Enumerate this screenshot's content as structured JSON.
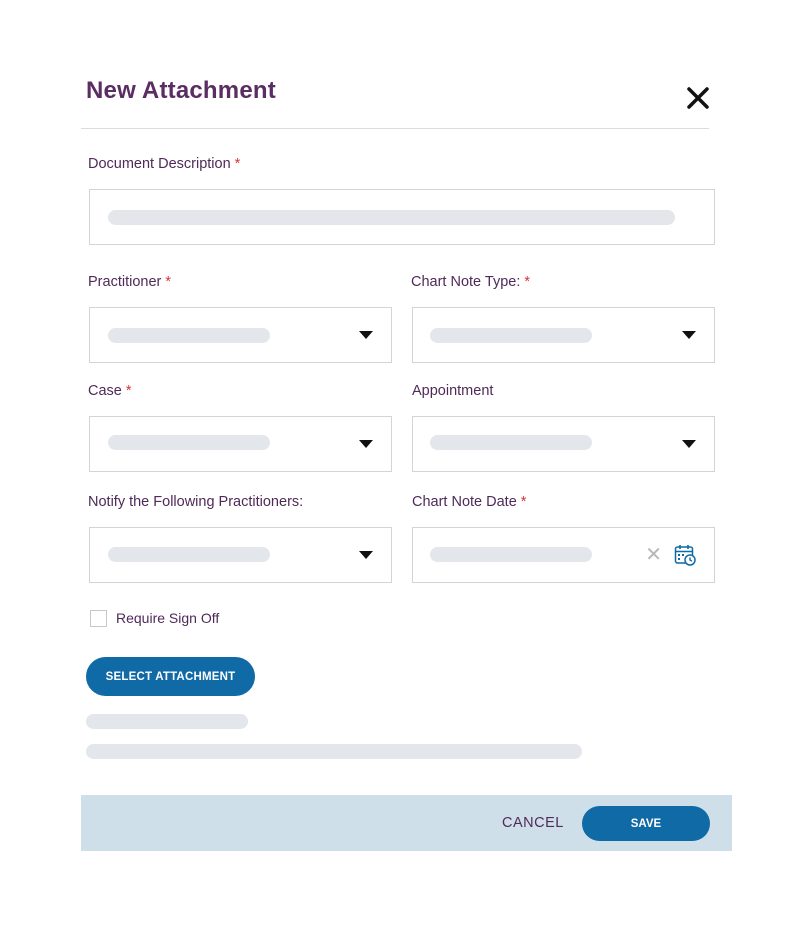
{
  "dialog": {
    "title": "New Attachment"
  },
  "fields": {
    "document_description": {
      "label": "Document Description",
      "required_mark": "*"
    },
    "practitioner": {
      "label": "Practitioner",
      "required_mark": "*"
    },
    "chart_note_type": {
      "label": "Chart Note Type:",
      "required_mark": "*"
    },
    "case": {
      "label": "Case",
      "required_mark": "*"
    },
    "appointment": {
      "label": "Appointment"
    },
    "notify_practitioners": {
      "label": "Notify the Following Practitioners:"
    },
    "chart_note_date": {
      "label": "Chart Note Date",
      "required_mark": "*",
      "clear_glyph": "✕"
    }
  },
  "require_sign_off": {
    "label": "Require Sign Off",
    "checked": false
  },
  "select_attachment_button": {
    "label": "SELECT ATTACHMENT"
  },
  "footer": {
    "cancel_label": "CANCEL",
    "save_label": "SAVE"
  },
  "icons": {
    "close": "close-icon",
    "dropdown": "caret-down-icon",
    "calendar": "calendar-icon",
    "clear": "clear-icon"
  },
  "colors": {
    "title": "#5a2d63",
    "primary_button": "#0f6aa6",
    "required": "#d93434",
    "footer_bg": "#cfdfe9",
    "skeleton": "#e3e6ea"
  }
}
